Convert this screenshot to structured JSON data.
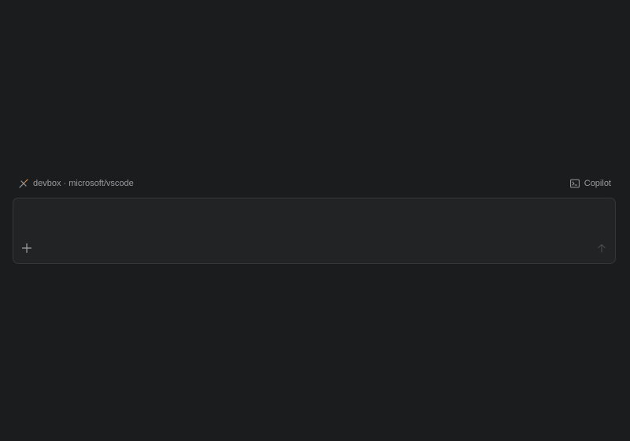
{
  "header": {
    "remote_label": "devbox · microsoft/vscode",
    "remote_icon": "remote-connection-icon",
    "agent_label": "Copilot",
    "agent_icon": "terminal-icon"
  },
  "composer": {
    "input_value": "",
    "input_placeholder": "",
    "add_icon": "plus-icon",
    "send_icon": "arrow-up-icon"
  },
  "colors": {
    "background": "#1b1c1e",
    "composer_bg": "#222325",
    "composer_border": "#36373a",
    "muted_text": "#9a9ba0",
    "accent_remote": "#d08a4e"
  }
}
